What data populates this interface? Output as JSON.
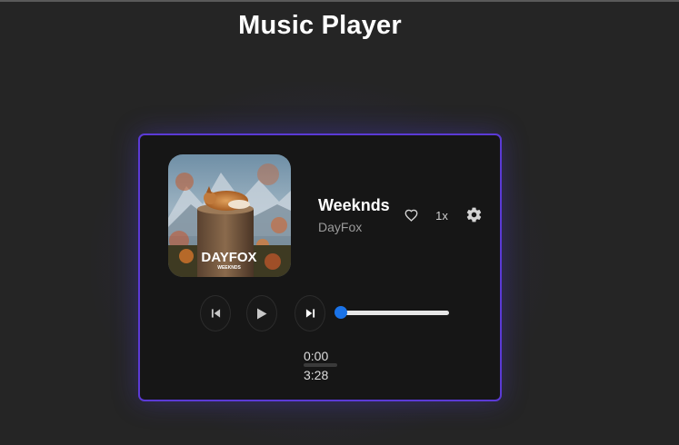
{
  "page": {
    "title": "Music Player"
  },
  "player": {
    "album_art": {
      "brand_text": "DAYFOX",
      "subtitle_text": "WEEKNDS"
    },
    "track": {
      "title": "Weeknds",
      "artist": "DayFox"
    },
    "actions": {
      "like_icon": "heart-outline-icon",
      "speed_label": "1x",
      "settings_icon": "gear-icon"
    },
    "controls": {
      "previous_icon": "skip-previous-icon",
      "play_icon": "play-icon",
      "next_icon": "skip-next-icon"
    },
    "progress": {
      "value_fraction": 0.0,
      "current_time": "0:00",
      "duration": "3:28"
    }
  },
  "colors": {
    "background": "#252525",
    "card": "#161616",
    "card_border": "#5b3ad6",
    "accent": "#1a73e8",
    "text_primary": "#ffffff",
    "text_secondary": "#9b9b9b"
  }
}
